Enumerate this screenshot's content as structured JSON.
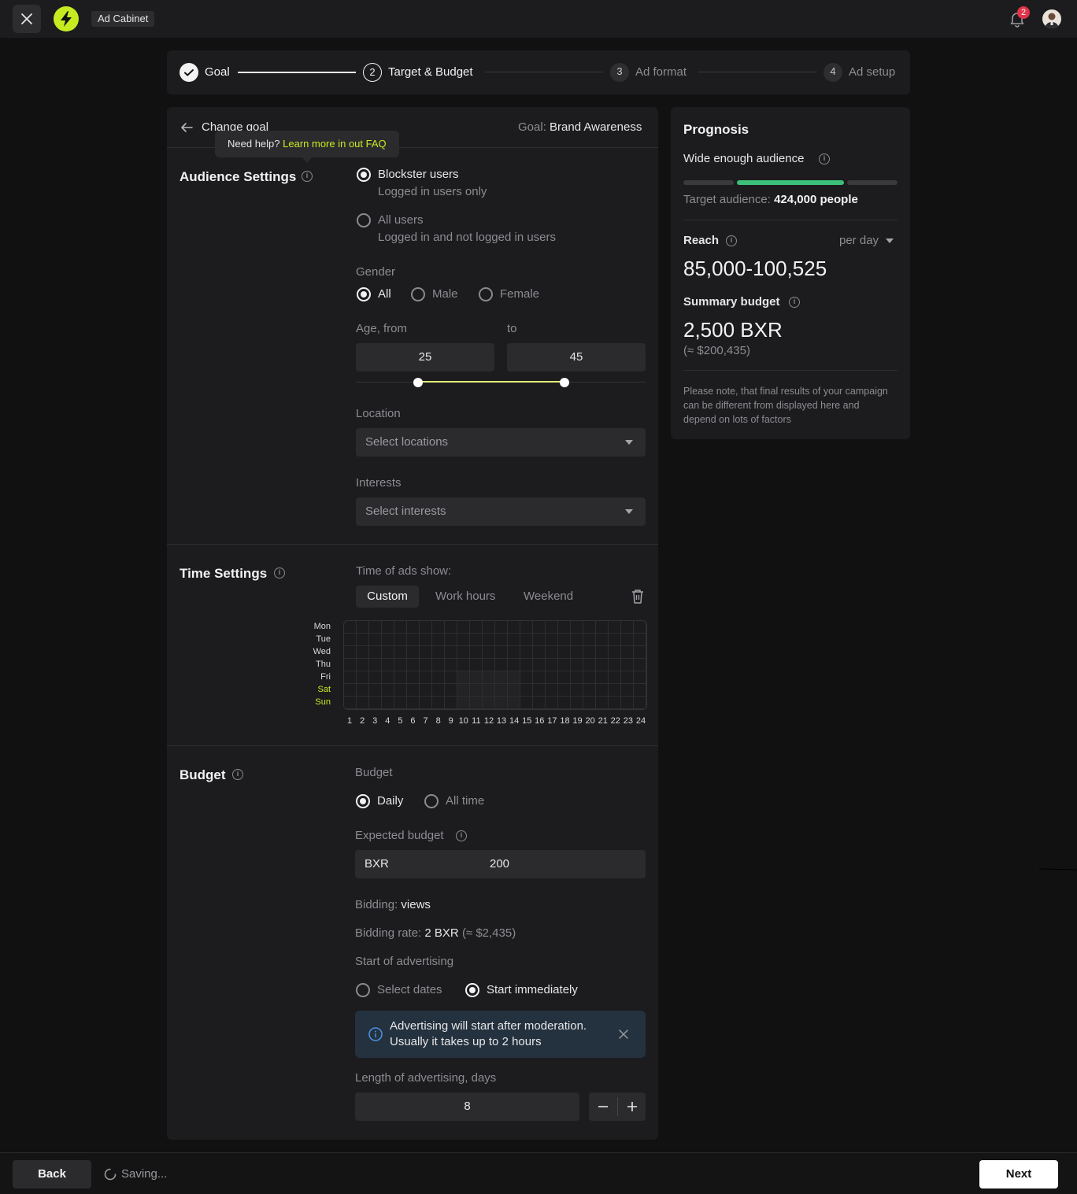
{
  "topbar": {
    "app_name": "Ad Cabinet",
    "notifications_count": "2",
    "icons": [
      "close-icon",
      "lightning-icon",
      "bell-icon",
      "avatar"
    ]
  },
  "colors": {
    "accent": "#c6ec21",
    "success": "#3bc07a",
    "info": "#4a8fe0",
    "badge": "#e0344a"
  },
  "stepper": {
    "steps": [
      {
        "num": "",
        "label": "Goal",
        "state": "done"
      },
      {
        "num": "2",
        "label": "Target & Budget",
        "state": "active"
      },
      {
        "num": "3",
        "label": "Ad format",
        "state": "pending"
      },
      {
        "num": "4",
        "label": "Ad setup",
        "state": "pending"
      }
    ]
  },
  "header": {
    "back_label": "Change goal",
    "goal_prefix": "Goal:",
    "goal_value": "Brand Awareness"
  },
  "tooltip": {
    "text": "Need help?",
    "link": "Learn more in out FAQ"
  },
  "audience": {
    "title": "Audience Settings",
    "user_options": [
      {
        "label": "Blockster users",
        "sub": "Logged in users only",
        "selected": true
      },
      {
        "label": "All users",
        "sub": "Logged in and not logged in users",
        "selected": false
      }
    ],
    "gender_label": "Gender",
    "gender_options": [
      "All",
      "Male",
      "Female"
    ],
    "gender_selected": "All",
    "age_from_label": "Age, from",
    "age_to_label": "to",
    "age_from": "25",
    "age_to": "45",
    "location_label": "Location",
    "location_placeholder": "Select locations",
    "interests_label": "Interests",
    "interests_placeholder": "Select interests"
  },
  "time": {
    "title": "Time Settings",
    "time_label": "Time of ads show:",
    "tabs": [
      "Custom",
      "Work hours",
      "Weekend"
    ],
    "active_tab": "Custom",
    "days": [
      "Mon",
      "Tue",
      "Wed",
      "Thu",
      "Fri",
      "Sat",
      "Sun"
    ],
    "hours": [
      "1",
      "2",
      "3",
      "4",
      "5",
      "6",
      "7",
      "8",
      "9",
      "10",
      "11",
      "12",
      "13",
      "14",
      "15",
      "16",
      "17",
      "18",
      "19",
      "20",
      "21",
      "22",
      "23",
      "24"
    ]
  },
  "budget": {
    "title": "Budget",
    "type_label": "Budget",
    "type_options": [
      "Daily",
      "All time"
    ],
    "type_selected": "Daily",
    "expected_label": "Expected budget",
    "currency": "BXR",
    "amount": "200",
    "bidding_label": "Bidding:",
    "bidding_value": "views",
    "rate_label": "Bidding rate:",
    "rate_value": "2 BXR",
    "rate_approx": "(≈ $2,435)",
    "start_label": "Start of advertising",
    "start_options": [
      "Select dates",
      "Start immediately"
    ],
    "start_selected": "Start immediately",
    "notice_line1": "Advertising will start after moderation.",
    "notice_line2": "Usually it takes up to 2 hours",
    "length_label": "Length of advertising, days",
    "length_value": "8"
  },
  "prognosis": {
    "title": "Prognosis",
    "audience_label": "Wide enough audience",
    "audience_level_segment": 2,
    "target_label": "Target audience:",
    "target_value": "424,000 people",
    "reach_label": "Reach",
    "reach_period": "per day",
    "reach_value": "85,000-100,525",
    "summary_label": "Summary budget",
    "summary_value": "2,500 BXR",
    "summary_approx": "(≈ $200,435)",
    "note": "Please note, that final results of your campaign can be different from displayed here and depend on lots of factors"
  },
  "footer": {
    "back_label": "Back",
    "status": "Saving...",
    "next_label": "Next"
  }
}
